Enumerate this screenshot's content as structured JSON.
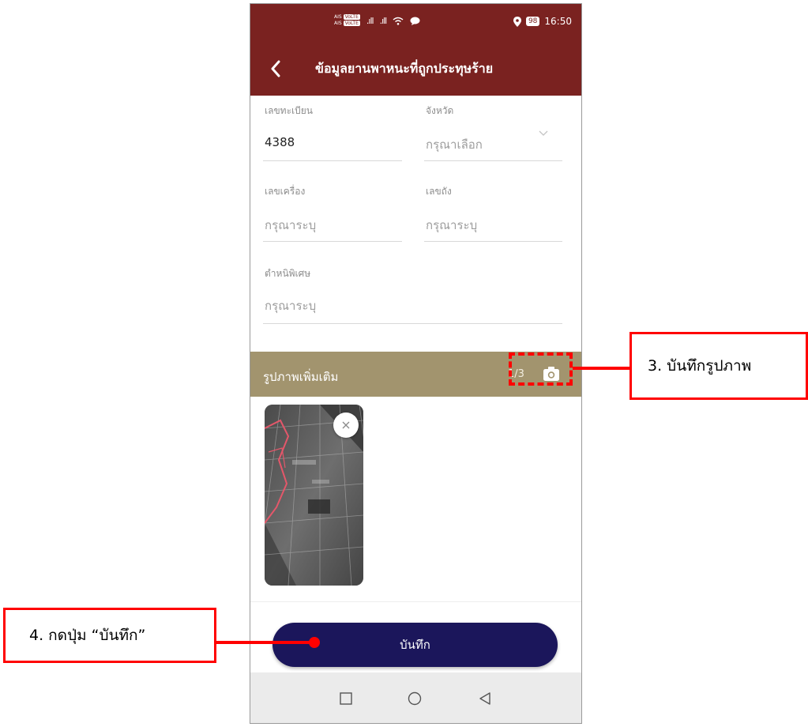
{
  "status_bar": {
    "carrier_1": "AIS",
    "carrier_2": "AIS",
    "volte_1": "VoLTE",
    "volte_2": "VoLTE",
    "battery": "98",
    "time": "16:50"
  },
  "app_bar": {
    "title": "ข้อมูลยานพาหนะที่ถูกประทุษร้าย"
  },
  "form": {
    "plate": {
      "label": "เลขทะเบียน",
      "value": "4388"
    },
    "province": {
      "label": "จังหวัด",
      "placeholder": "กรุณาเลือก"
    },
    "engine": {
      "label": "เลขเครื่อง",
      "placeholder": "กรุณาระบุ"
    },
    "chassis": {
      "label": "เลขถัง",
      "placeholder": "กรุณาระบุ"
    },
    "marks": {
      "label": "ตำหนิพิเศษ",
      "placeholder": "กรุณาระบุ"
    }
  },
  "photos": {
    "title": "รูปภาพเพิ่มเติม",
    "count": "1/3",
    "items": [
      {
        "remove_icon": "close-icon"
      }
    ]
  },
  "save_button": {
    "label": "บันทึก"
  },
  "nav_bar": {
    "icons": [
      "square-icon",
      "circle-icon",
      "triangle-back-icon"
    ]
  },
  "annotations": {
    "step3": "3. บันทึกรูปภาพ",
    "step4": "4. กดปุ่ม “บันทึก”",
    "color": "#ff0000"
  },
  "colors": {
    "app_bar": "#7a2220",
    "photo_header": "#a2946e",
    "save_button": "#1b165b"
  }
}
